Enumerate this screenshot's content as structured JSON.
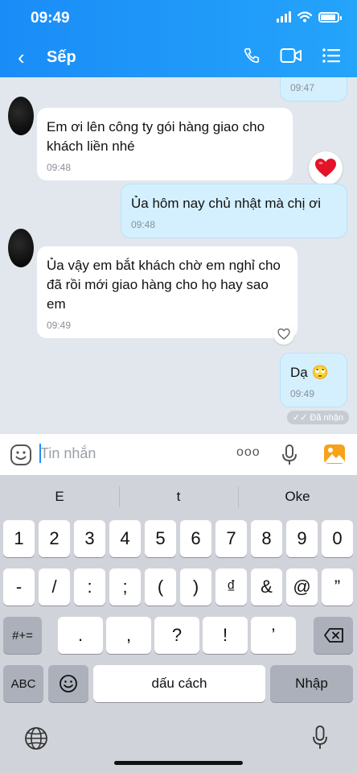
{
  "status": {
    "time": "09:49"
  },
  "header": {
    "back_label": "‹",
    "title": "Sếp"
  },
  "messages": [
    {
      "time": "09:47"
    },
    {
      "text": "Em ơi lên công ty gói hàng giao cho khách liền nhé",
      "time": "09:48"
    },
    {
      "text": "Ủa hôm nay chủ nhật mà chị ơi",
      "time": "09:48"
    },
    {
      "text": "Ủa vậy em bắt khách chờ em nghỉ cho đã rồi mới giao hàng cho họ hay sao em",
      "time": "09:49"
    },
    {
      "text": "Dạ 🙄",
      "time": "09:49"
    }
  ],
  "seen_label": "✓✓ Đã nhận",
  "input": {
    "placeholder": "Tin nhắn",
    "more_label": "ooo"
  },
  "keyboard": {
    "suggestions": [
      "E",
      "t",
      "Oke"
    ],
    "row1": [
      "1",
      "2",
      "3",
      "4",
      "5",
      "6",
      "7",
      "8",
      "9",
      "0"
    ],
    "row2": [
      "-",
      "/",
      ":",
      ";",
      "(",
      ")",
      "₫",
      "&",
      "@",
      "”"
    ],
    "row3_left": "#+=",
    "row3": [
      ".",
      ",",
      "?",
      "!",
      "’"
    ],
    "abc": "ABC",
    "space": "dấu cách",
    "enter": "Nhập"
  },
  "colors": {
    "header": "#1a8cf7",
    "bubble_out": "#d4f0ff",
    "heart": "#e3132a"
  }
}
